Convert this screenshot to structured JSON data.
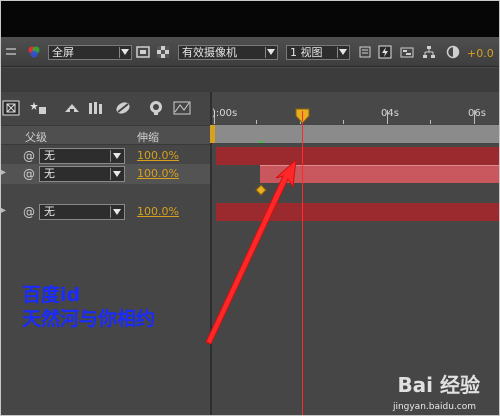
{
  "viewer_toolbar": {
    "view_mode": "全屏",
    "camera": "有效摄像机",
    "views": "1 视图",
    "exposure_value": "+0.0"
  },
  "columns": {
    "parent": "父级",
    "stretch": "伸缩"
  },
  "layers": [
    {
      "parent": "无",
      "stretch": "100.0%"
    },
    {
      "parent": "无",
      "stretch": "100.0%"
    },
    {
      "parent": "无",
      "stretch": "100.0%"
    }
  ],
  "ruler_labels": {
    "start": "):00s",
    "t4": "04s",
    "t6": "06s"
  },
  "annotation": {
    "line1": "百度id",
    "line2": "天然河与你相约"
  },
  "watermark": {
    "brand": "Bai 经验",
    "url": "jingyan.baidu.com"
  },
  "colors": {
    "layer_bar": "#9a2a2e",
    "selected_layer_bar": "#c8585e",
    "playhead": "#ff2a2a",
    "stretch_text": "#d8a01f",
    "annotation": "#1a2bff"
  }
}
